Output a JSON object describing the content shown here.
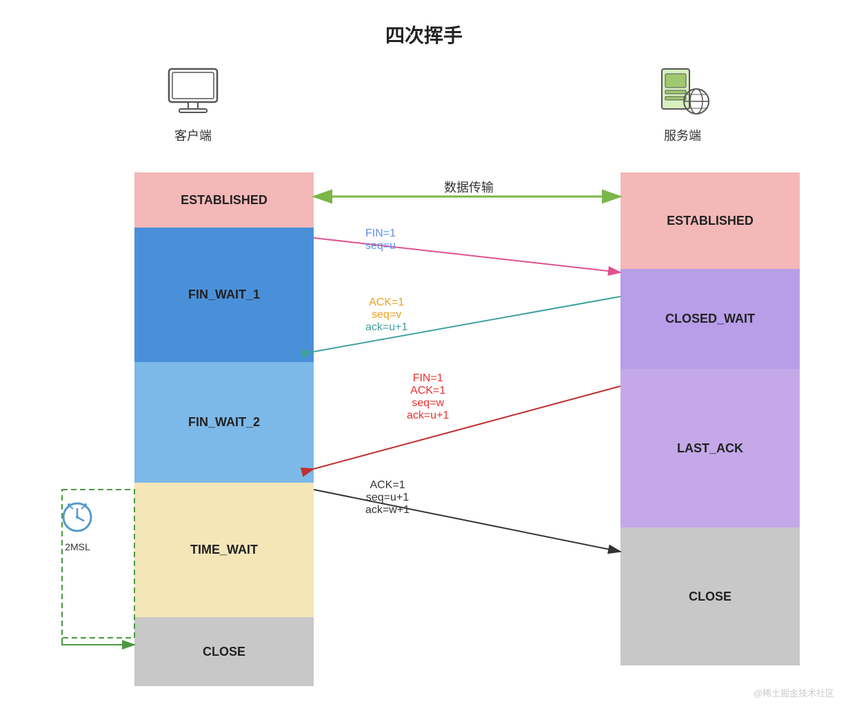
{
  "title": "四次挥手",
  "client_label": "客户端",
  "server_label": "服务端",
  "data_transfer": "数据传输",
  "states": {
    "established": "ESTABLISHED",
    "fin_wait_1": "FIN_WAIT_1",
    "fin_wait_2": "FIN_WAIT_2",
    "time_wait": "TIME_WAIT",
    "close_client": "CLOSE",
    "closed_wait": "CLOSED_WAIT",
    "last_ack": "LAST_ACK",
    "close_server": "CLOSE"
  },
  "arrows": {
    "fin1": "FIN=1\nseq=u",
    "fin1_line1": "FIN=1",
    "fin1_line2": "seq=u",
    "ack1_line1": "ACK=1",
    "ack1_line2": "seq=v",
    "ack1_line3": "ack=u+1",
    "fin2_line1": "FIN=1",
    "fin2_line2": "ACK=1",
    "fin2_line3": "seq=w",
    "fin2_line4": "ack=u+1",
    "ack2_line1": "ACK=1",
    "ack2_line2": "seq=u+1",
    "ack2_line3": "ack=w+1"
  },
  "msl": "2MSL",
  "watermark": "@稀土掘金技术社区"
}
